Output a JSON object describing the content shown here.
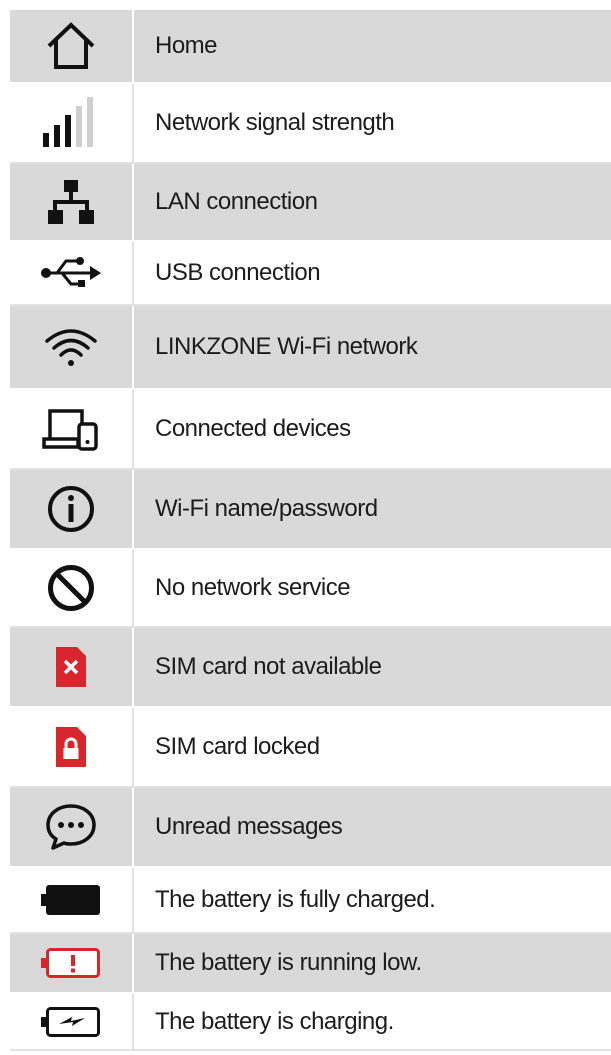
{
  "legend": {
    "rows": [
      {
        "label": "Home",
        "icon": "home-icon"
      },
      {
        "label": "Network signal strength",
        "icon": "signal-strength-icon"
      },
      {
        "label": "LAN connection",
        "icon": "lan-icon"
      },
      {
        "label": "USB connection",
        "icon": "usb-icon"
      },
      {
        "label": "LINKZONE Wi-Fi network",
        "icon": "wifi-icon"
      },
      {
        "label": "Connected devices",
        "icon": "devices-icon"
      },
      {
        "label": "Wi-Fi name/password",
        "icon": "info-icon"
      },
      {
        "label": "No network service",
        "icon": "no-service-icon"
      },
      {
        "label": "SIM card not available",
        "icon": "sim-unavailable-icon"
      },
      {
        "label": "SIM card locked",
        "icon": "sim-locked-icon"
      },
      {
        "label": "Unread messages",
        "icon": "message-icon"
      },
      {
        "label": "The battery is fully charged.",
        "icon": "battery-full-icon"
      },
      {
        "label": "The battery is running low.",
        "icon": "battery-low-icon"
      },
      {
        "label": "The battery is charging.",
        "icon": "battery-charging-icon"
      }
    ]
  },
  "colors": {
    "row_shade": "#d9d9d9",
    "alert_red": "#d9262c",
    "text": "#1c1c1c"
  }
}
